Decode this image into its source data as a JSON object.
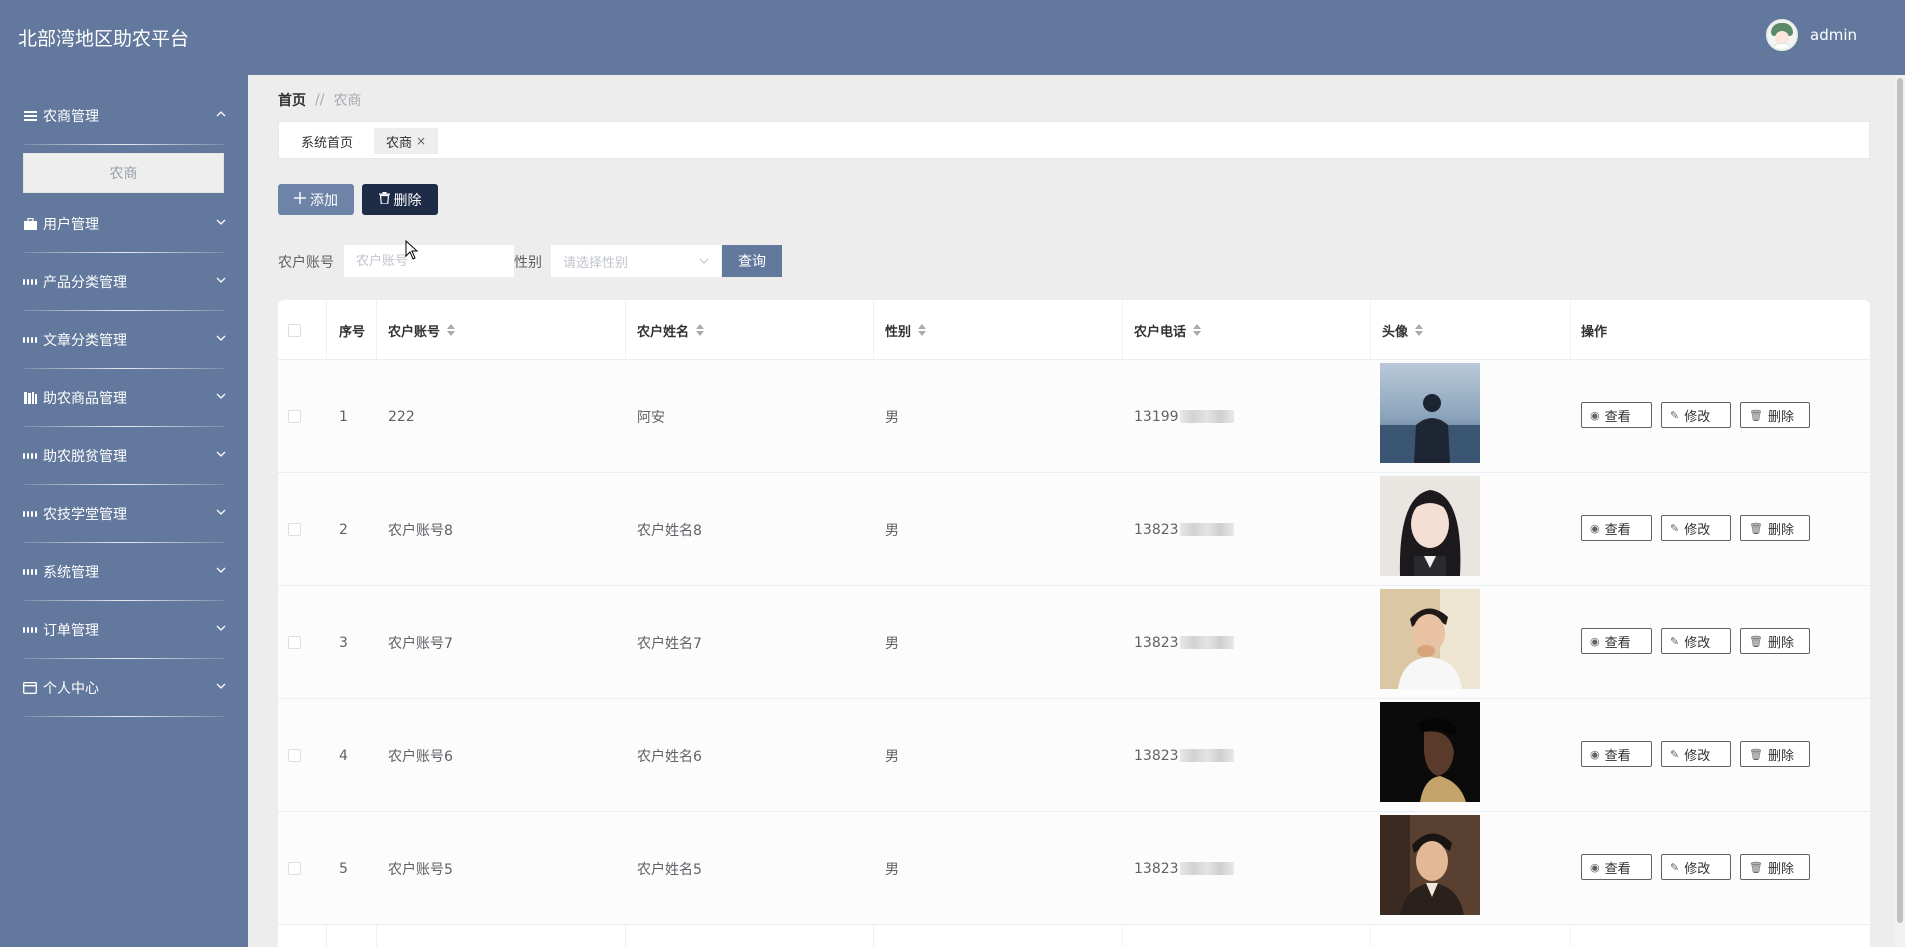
{
  "app": {
    "title": "北部湾地区助农平台"
  },
  "user": {
    "name": "admin"
  },
  "sidebar": {
    "items": [
      {
        "label": "农商管理",
        "icon": "list-icon",
        "expanded": true,
        "children": [
          "农商"
        ]
      },
      {
        "label": "用户管理",
        "icon": "briefcase-icon"
      },
      {
        "label": "产品分类管理",
        "icon": "grid-icon"
      },
      {
        "label": "文章分类管理",
        "icon": "grid-icon"
      },
      {
        "label": "助农商品管理",
        "icon": "books-icon"
      },
      {
        "label": "助农脱贫管理",
        "icon": "grid-icon"
      },
      {
        "label": "农技学堂管理",
        "icon": "grid-icon"
      },
      {
        "label": "系统管理",
        "icon": "grid-icon"
      },
      {
        "label": "订单管理",
        "icon": "grid-icon"
      },
      {
        "label": "个人中心",
        "icon": "card-icon"
      }
    ]
  },
  "breadcrumb": {
    "home": "首页",
    "separator": "//",
    "current": "农商"
  },
  "tabs": [
    {
      "label": "系统首页",
      "active": false
    },
    {
      "label": "农商",
      "active": true,
      "close": "×"
    }
  ],
  "toolbar": {
    "add_label": "添加",
    "delete_label": "删除"
  },
  "search": {
    "account_label": "农户账号",
    "account_placeholder": "农户账号",
    "gender_label": "性别",
    "gender_placeholder": "请选择性别",
    "query_label": "查询"
  },
  "table": {
    "columns": [
      "序号",
      "农户账号",
      "农户姓名",
      "性别",
      "农户电话",
      "头像",
      "操作"
    ],
    "rows": [
      {
        "index": "1",
        "account": "222",
        "name": "阿安",
        "gender": "男",
        "phone": "13199"
      },
      {
        "index": "2",
        "account": "农户账号8",
        "name": "农户姓名8",
        "gender": "男",
        "phone": "13823"
      },
      {
        "index": "3",
        "account": "农户账号7",
        "name": "农户姓名7",
        "gender": "男",
        "phone": "13823"
      },
      {
        "index": "4",
        "account": "农户账号6",
        "name": "农户姓名6",
        "gender": "男",
        "phone": "13823"
      },
      {
        "index": "5",
        "account": "农户账号5",
        "name": "农户姓名5",
        "gender": "男",
        "phone": "13823"
      }
    ],
    "actions": {
      "view": "查看",
      "edit": "修改",
      "delete": "删除"
    }
  },
  "colors": {
    "header": "#62789c",
    "sidebar": "#62789c",
    "delete_button": "#1e2c48",
    "add_button": "#6d83a8"
  }
}
